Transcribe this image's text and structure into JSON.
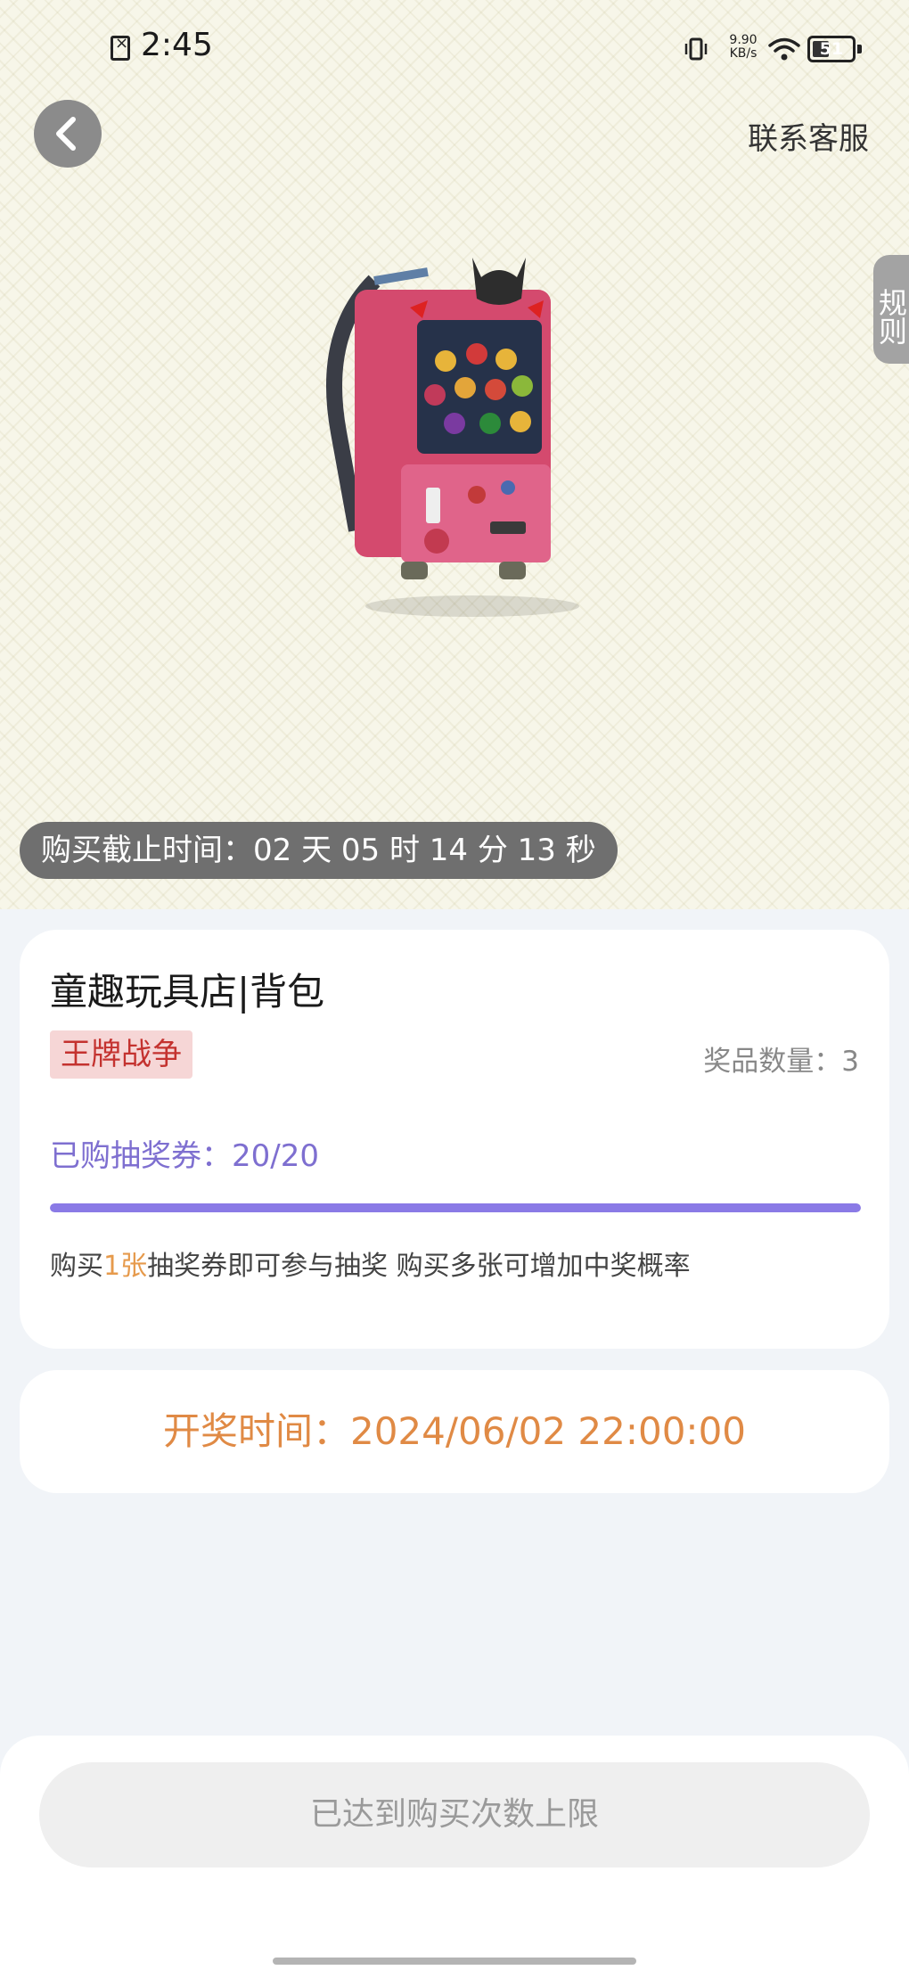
{
  "status_bar": {
    "time": "2:45",
    "net_speed_value": "9.90",
    "net_speed_unit": "KB/s",
    "battery": "51",
    "battery_level": 0.51
  },
  "header": {
    "contact_label": "联系客服",
    "rules_label": "规则"
  },
  "product": {
    "image_icon": "pink-arcade-backpack-image",
    "deadline_text": "购买截止时间：02 天 05 时 14 分 13 秒",
    "title": "童趣玩具店|背包",
    "tag": "王牌战争",
    "prize_count": "奖品数量：3",
    "tickets_label": "已购抽奖券：20/20",
    "tickets_progress": 1.0,
    "hint_prefix": "购买",
    "hint_highlight": "1张",
    "hint_suffix": "抽奖券即可参与抽奖 购买多张可增加中奖概率"
  },
  "draw": {
    "time_text": "开奖时间：2024/06/02 22:00:00"
  },
  "footer": {
    "button_label": "已达到购买次数上限"
  },
  "colors": {
    "accent_purple": "#8a7ae6",
    "accent_orange": "#e08a45",
    "tag_red": "#c4322f"
  }
}
